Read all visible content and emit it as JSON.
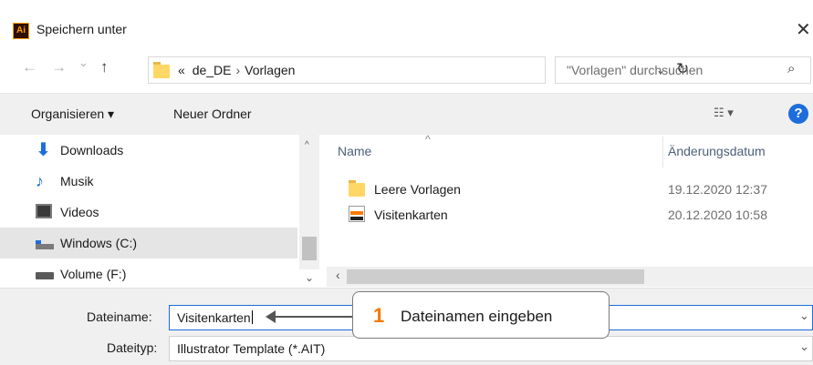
{
  "window": {
    "app_icon_text": "Ai",
    "title": "Speichern unter",
    "close_glyph": "✕"
  },
  "navigation": {
    "back_glyph": "←",
    "forward_glyph": "→",
    "recent_glyph": "⌄",
    "up_glyph": "↑",
    "breadcrumb_overflow": "«",
    "breadcrumb": [
      "de_DE",
      "Vorlagen"
    ],
    "breadcrumb_separator": "›",
    "search_placeholder": "\"Vorlagen\" durchsuchen",
    "search_icon": "search-icon",
    "refresh_icon": "refresh-icon"
  },
  "toolbar": {
    "organize": "Organisieren ▾",
    "new_folder": "Neuer Ordner",
    "view_glyph": "☷ ▾",
    "help_glyph": "?"
  },
  "sidebar": {
    "items": [
      {
        "label": "Downloads",
        "icon": "download-icon"
      },
      {
        "label": "Musik",
        "icon": "music-icon"
      },
      {
        "label": "Videos",
        "icon": "video-icon"
      },
      {
        "label": "Windows (C:)",
        "icon": "drive-icon",
        "selected": true
      },
      {
        "label": "Volume (F:)",
        "icon": "volume-drive-icon"
      }
    ]
  },
  "filelist": {
    "columns": {
      "name": "Name",
      "date": "Änderungsdatum"
    },
    "rows": [
      {
        "name": "Leere Vorlagen",
        "date": "19.12.2020 12:37",
        "icon": "folder-icon"
      },
      {
        "name": "Visitenkarten",
        "date": "20.12.2020 10:58",
        "icon": "ai-template-file-icon"
      }
    ]
  },
  "form": {
    "filename_label": "Dateiname:",
    "filename_value": "Visitenkarten",
    "filetype_label": "Dateityp:",
    "filetype_value": "Illustrator Template (*.AIT)"
  },
  "callout": {
    "number": "1",
    "text": "Dateinamen eingeben"
  },
  "colors": {
    "accent": "#1d6ddc",
    "callout_number": "#f07800"
  }
}
